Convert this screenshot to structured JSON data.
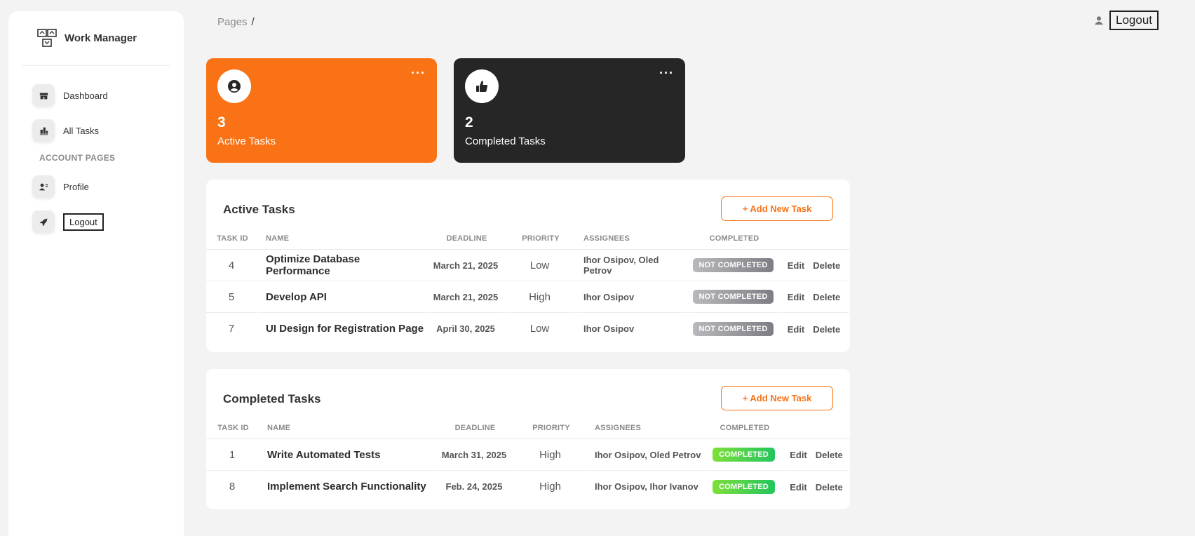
{
  "brand": {
    "name": "Work Manager"
  },
  "sidebar": {
    "items": [
      {
        "label": "Dashboard"
      },
      {
        "label": "All Tasks"
      }
    ],
    "section_label": "ACCOUNT PAGES",
    "account_items": [
      {
        "label": "Profile"
      },
      {
        "label": "Logout"
      }
    ]
  },
  "breadcrumb": {
    "root": "Pages",
    "separator": "/"
  },
  "topbar": {
    "logout_label": "Logout"
  },
  "stats": [
    {
      "value": "3",
      "label": "Active Tasks",
      "color": "#f97316"
    },
    {
      "value": "2",
      "label": "Completed Tasks",
      "color": "#262626"
    }
  ],
  "columns": {
    "task_id": "TASK ID",
    "name": "NAME",
    "deadline": "DEADLINE",
    "priority": "PRIORITY",
    "assignees": "ASSIGNEES",
    "completed": "COMPLETED"
  },
  "actions": {
    "edit": "Edit",
    "delete": "Delete"
  },
  "active_panel": {
    "title": "Active Tasks",
    "add_label": "+ Add New Task",
    "rows": [
      {
        "id": "4",
        "name": "Optimize Database Performance",
        "deadline": "March 21, 2025",
        "priority": "Low",
        "assignees": "Ihor Osipov, Oled Petrov",
        "status": "NOT COMPLETED"
      },
      {
        "id": "5",
        "name": "Develop API",
        "deadline": "March 21, 2025",
        "priority": "High",
        "assignees": "Ihor Osipov",
        "status": "NOT COMPLETED"
      },
      {
        "id": "7",
        "name": "UI Design for Registration Page",
        "deadline": "April 30, 2025",
        "priority": "Low",
        "assignees": "Ihor Osipov",
        "status": "NOT COMPLETED"
      }
    ]
  },
  "completed_panel": {
    "title": "Completed Tasks",
    "add_label": "+ Add New Task",
    "rows": [
      {
        "id": "1",
        "name": "Write Automated Tests",
        "deadline": "March 31, 2025",
        "priority": "High",
        "assignees": "Ihor Osipov, Oled Petrov",
        "status": "COMPLETED"
      },
      {
        "id": "8",
        "name": "Implement Search Functionality",
        "deadline": "Feb. 24, 2025",
        "priority": "High",
        "assignees": "Ihor Osipov, Ihor Ivanov",
        "status": "COMPLETED"
      }
    ]
  },
  "colors": {
    "accent": "#f97316",
    "dark": "#262626",
    "success": "#22c55e",
    "muted": "#7d7d84"
  }
}
